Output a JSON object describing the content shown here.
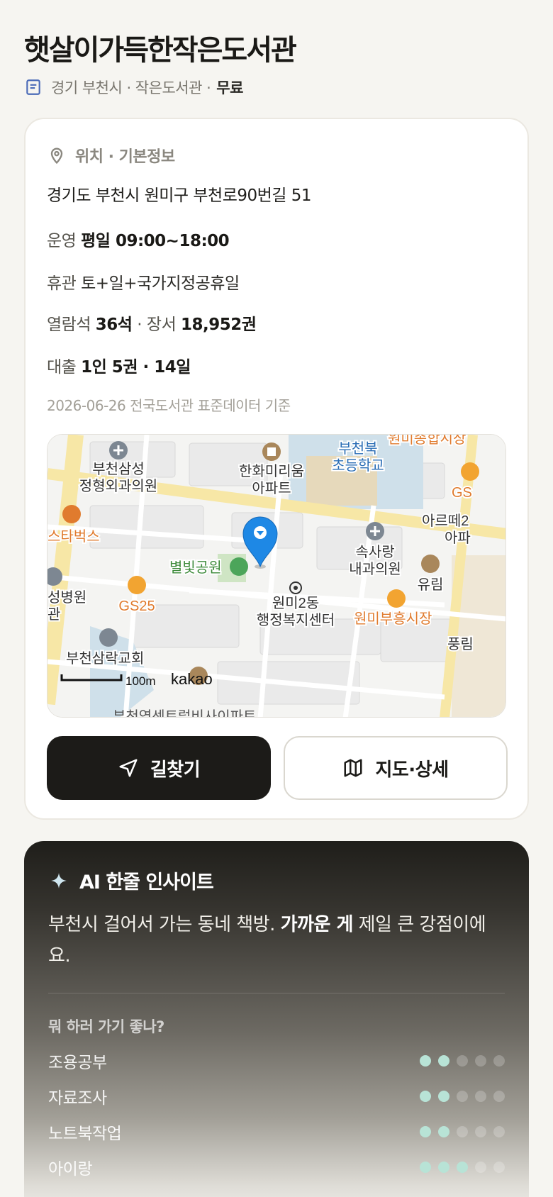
{
  "library": {
    "name": "햇살이가득한작은도서관",
    "region": "경기 부천시 · 작은도서관 ·",
    "fee": "무료"
  },
  "info": {
    "section_title": "위치 · 기본정보",
    "address": "경기도 부천시 원미구 부천로90번길 51",
    "hours_label": "운영",
    "hours_value": "평일 09:00~18:00",
    "closed_label": "휴관",
    "closed_value": "토+일+국가지정공휴일",
    "seats_label": "열람석",
    "seats_value": "36석",
    "books_label": "· 장서",
    "books_value": "18,952권",
    "loan_label": "대출",
    "loan_value": "1인 5권 · 14일",
    "source": "2026-06-26 전국도서관 표준데이터 기준"
  },
  "map": {
    "labels": {
      "hospital1": "부천삼성\n정형외과의원",
      "apt": "한화미리움\n아파트",
      "school": "부천북\n초등학교",
      "market_top": "원미종합시장",
      "starbucks": "스타벅스",
      "arte": "아르떼2\n아파",
      "clinic2": "속사랑\n내과의원",
      "yurim": "유림",
      "park": "별빛공원",
      "hospital3": "성병원\n관",
      "gs25": "GS25",
      "gs_edge": "GS",
      "office": "원미2동\n행정복지센터",
      "market": "원미부흥시장",
      "church": "부천삼락교회",
      "pungrim": "풍림",
      "scale": "100m",
      "brand": "kakao",
      "bottom_cut": "부천역센트럴비사이파트"
    }
  },
  "actions": {
    "directions": "길찾기",
    "map_detail": "지도·상세"
  },
  "ai": {
    "title": "AI 한줄 인사이트",
    "text_before": "부천시 걸어서 가는 동네 책방. ",
    "text_bold": "가까운 게",
    "text_after": " 제일 큰 강점이에요.",
    "question": "뭐 하러 가기 좋나?",
    "activities": [
      {
        "label": "조용공부",
        "score": 2
      },
      {
        "label": "자료조사",
        "score": 2
      },
      {
        "label": "노트북작업",
        "score": 2
      },
      {
        "label": "아이랑",
        "score": 3
      }
    ]
  },
  "colors": {
    "accent_mint": "#b8e3d6",
    "pin_blue": "#1e88e5",
    "dark": "#1c1b18"
  }
}
